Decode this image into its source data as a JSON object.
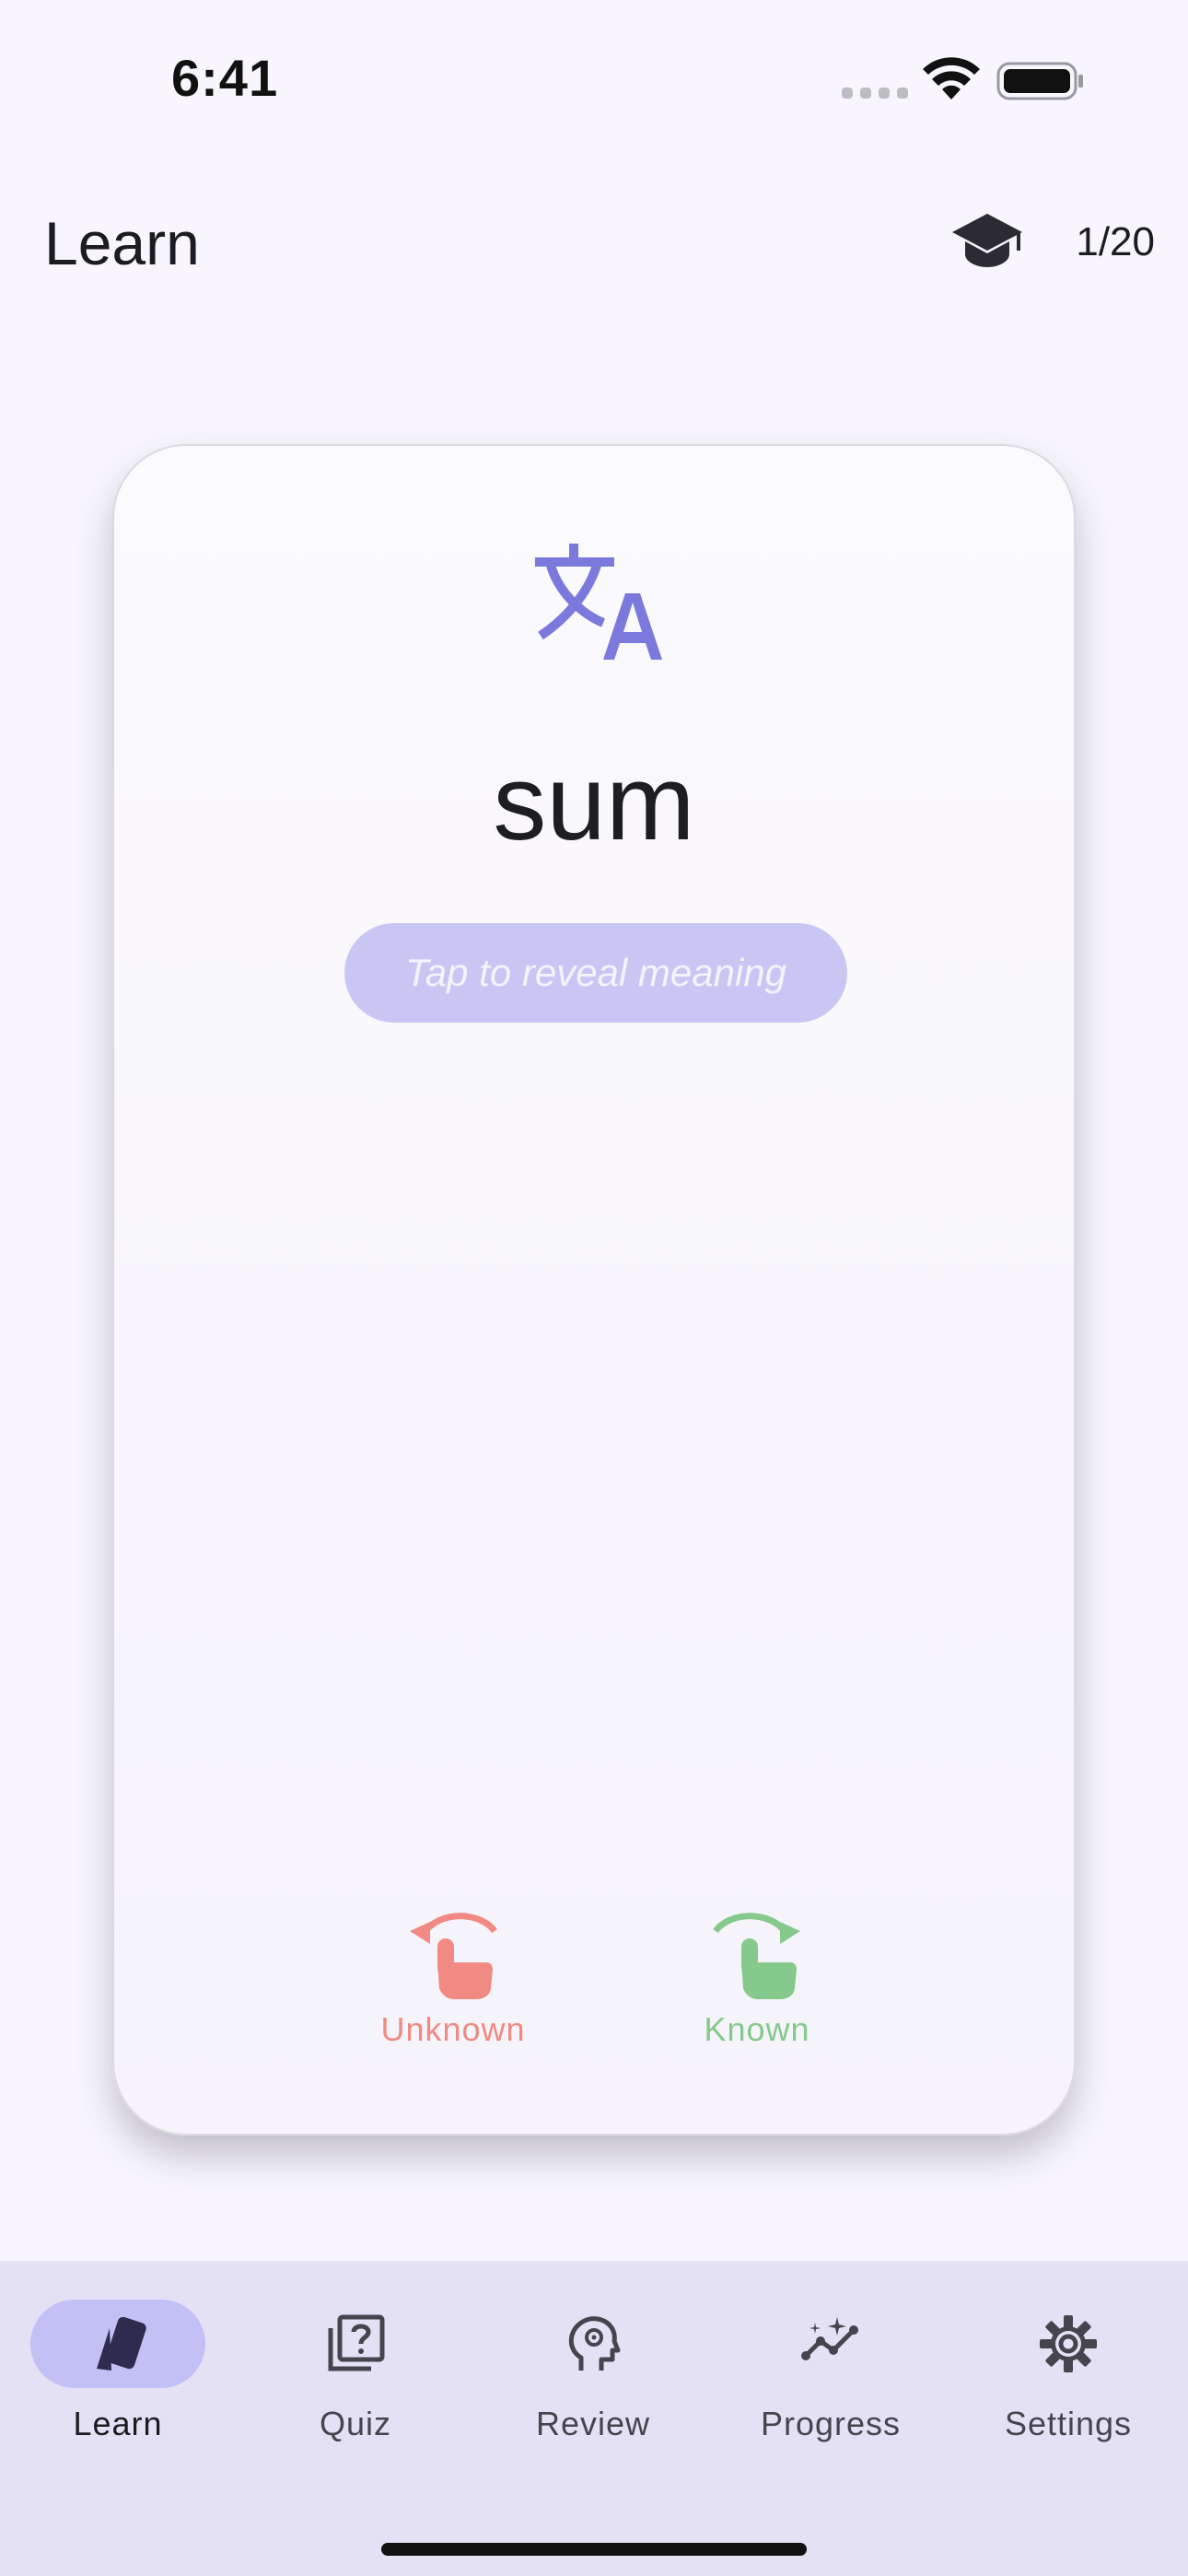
{
  "status_bar": {
    "time": "6:41"
  },
  "app_bar": {
    "title": "Learn",
    "progress": "1/20",
    "icon": "school-icon"
  },
  "card": {
    "icon": "translate-icon",
    "word": "sum",
    "reveal_hint": "Tap to reveal meaning",
    "unknown_label": "Unknown",
    "known_label": "Known",
    "unknown_icon": "swipe-left-icon",
    "known_icon": "swipe-right-icon"
  },
  "nav": {
    "items": [
      {
        "label": "Learn",
        "icon": "cards-icon",
        "active": true
      },
      {
        "label": "Quiz",
        "icon": "quiz-icon",
        "active": false
      },
      {
        "label": "Review",
        "icon": "psychology-icon",
        "active": false
      },
      {
        "label": "Progress",
        "icon": "insights-icon",
        "active": false
      },
      {
        "label": "Settings",
        "icon": "gear-icon",
        "active": false
      }
    ]
  },
  "colors": {
    "accent": "#7b79dc",
    "unknown": "#f08a82",
    "known": "#86c98c",
    "nav_background": "#e4e1f5",
    "nav_indicator": "#c3c0f6"
  }
}
